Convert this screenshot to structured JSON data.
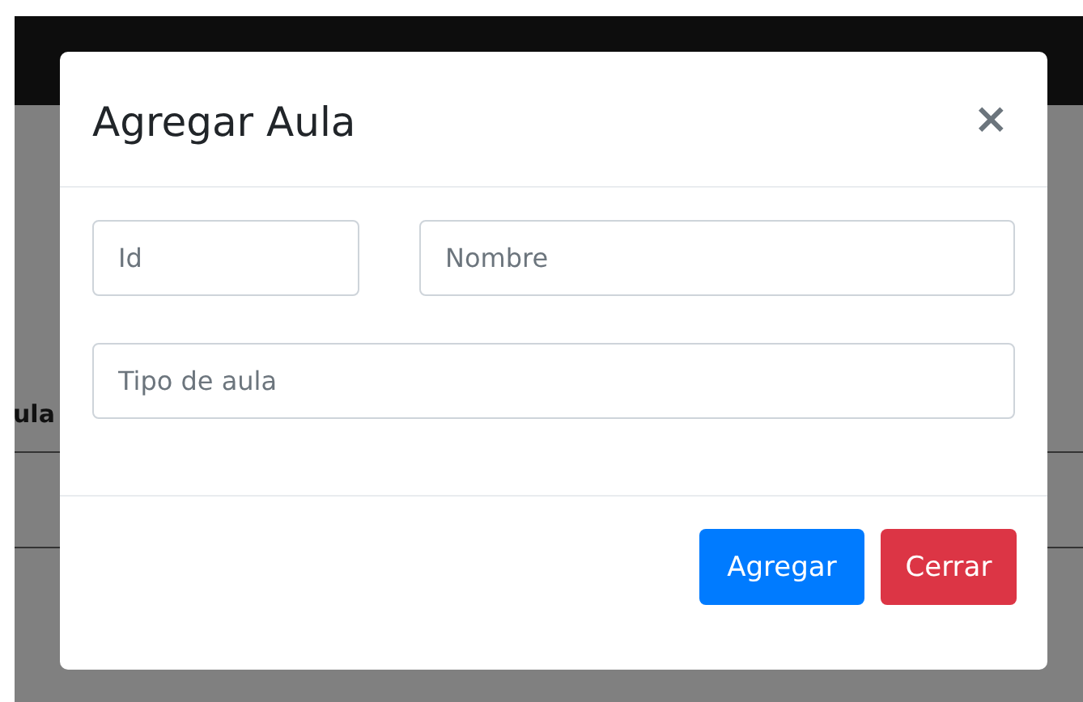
{
  "background": {
    "column_header": "ula"
  },
  "modal": {
    "title": "Agregar Aula",
    "close": "×",
    "fields": [
      {
        "placeholder": "Id"
      },
      {
        "placeholder": "Nombre"
      },
      {
        "placeholder": "Tipo de aula"
      }
    ],
    "buttons": [
      {
        "label": "Agregar",
        "kind": "primary"
      },
      {
        "label": "Cerrar",
        "kind": "danger"
      }
    ]
  }
}
